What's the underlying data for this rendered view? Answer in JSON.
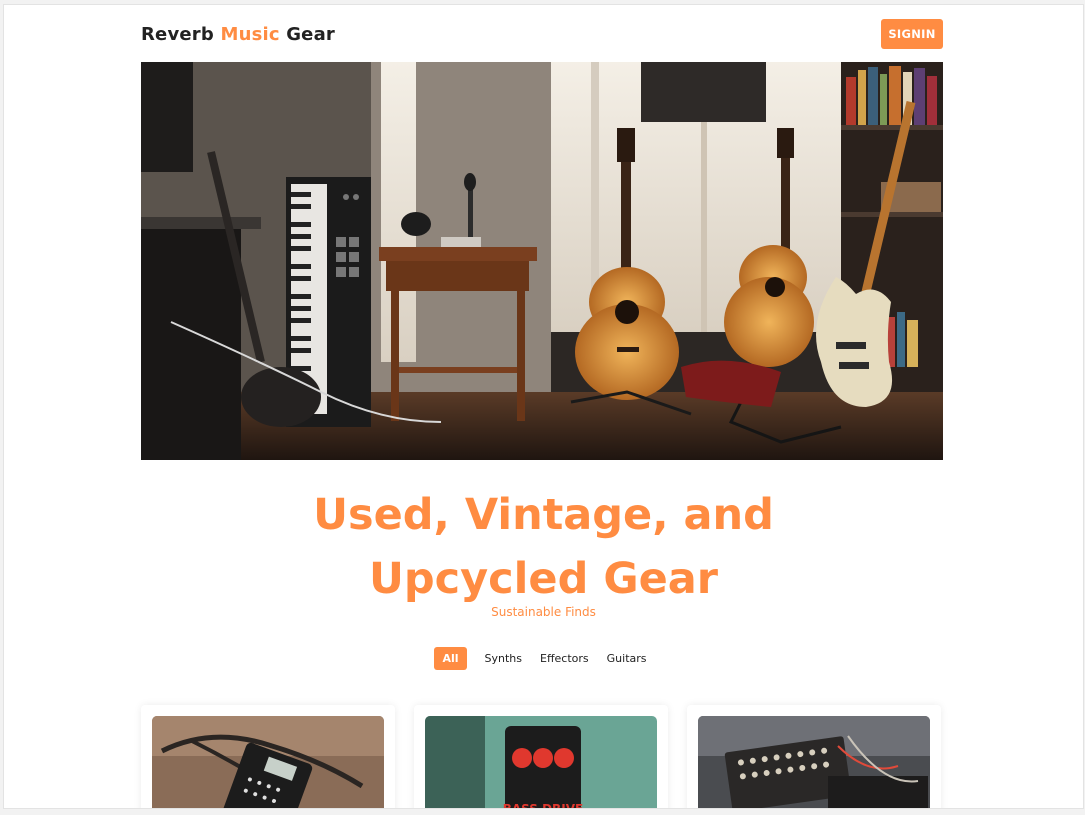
{
  "brand": {
    "part1": "Reverb",
    "part2": "Music",
    "part3": "Gear"
  },
  "header": {
    "signin_label": "SIGNIN"
  },
  "hero": {
    "line1": "Used, Vintage, and",
    "line2": "Upcycled Gear",
    "subtitle": "Sustainable Finds"
  },
  "filters": [
    {
      "label": "All",
      "active": true
    },
    {
      "label": "Synths",
      "active": false
    },
    {
      "label": "Effectors",
      "active": false
    },
    {
      "label": "Guitars",
      "active": false
    }
  ],
  "colors": {
    "accent": "#ff8c42",
    "text": "#222222",
    "background": "#ffffff"
  },
  "cards": [
    {
      "image": "pocket-synth-photo"
    },
    {
      "image": "bass-drive-pedal-photo"
    },
    {
      "image": "modular-synth-photo"
    }
  ]
}
